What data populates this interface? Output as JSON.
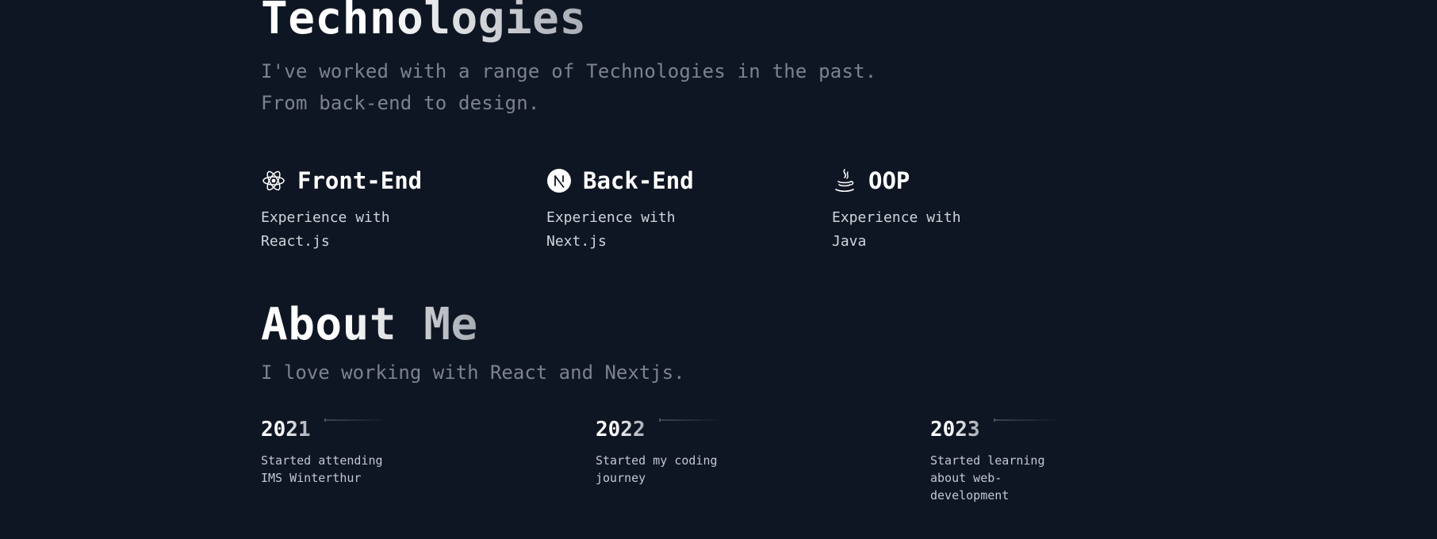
{
  "technologies": {
    "title": "Technologies",
    "subtitle_line1": "I've worked with a range of Technologies in the past.",
    "subtitle_line2": "From back-end to design.",
    "skills": [
      {
        "icon": "react-icon",
        "title": "Front-End",
        "description": "Experience with\nReact.js"
      },
      {
        "icon": "nextjs-icon",
        "title": "Back-End",
        "description": "Experience with\nNext.js"
      },
      {
        "icon": "java-icon",
        "title": "OOP",
        "description": "Experience with\nJava"
      }
    ]
  },
  "about": {
    "title": "About Me",
    "subtitle": "I love working with React and Nextjs.",
    "timeline": [
      {
        "year": "2021",
        "description": "Started attending\nIMS Winterthur"
      },
      {
        "year": "2022",
        "description": "Started my coding\njourney"
      },
      {
        "year": "2023",
        "description": "Started learning\nabout web-\ndevelopment"
      }
    ]
  },
  "colors": {
    "background": "#0f1623",
    "muted_text": "#7d828c",
    "heading_text": "#ffffff"
  }
}
